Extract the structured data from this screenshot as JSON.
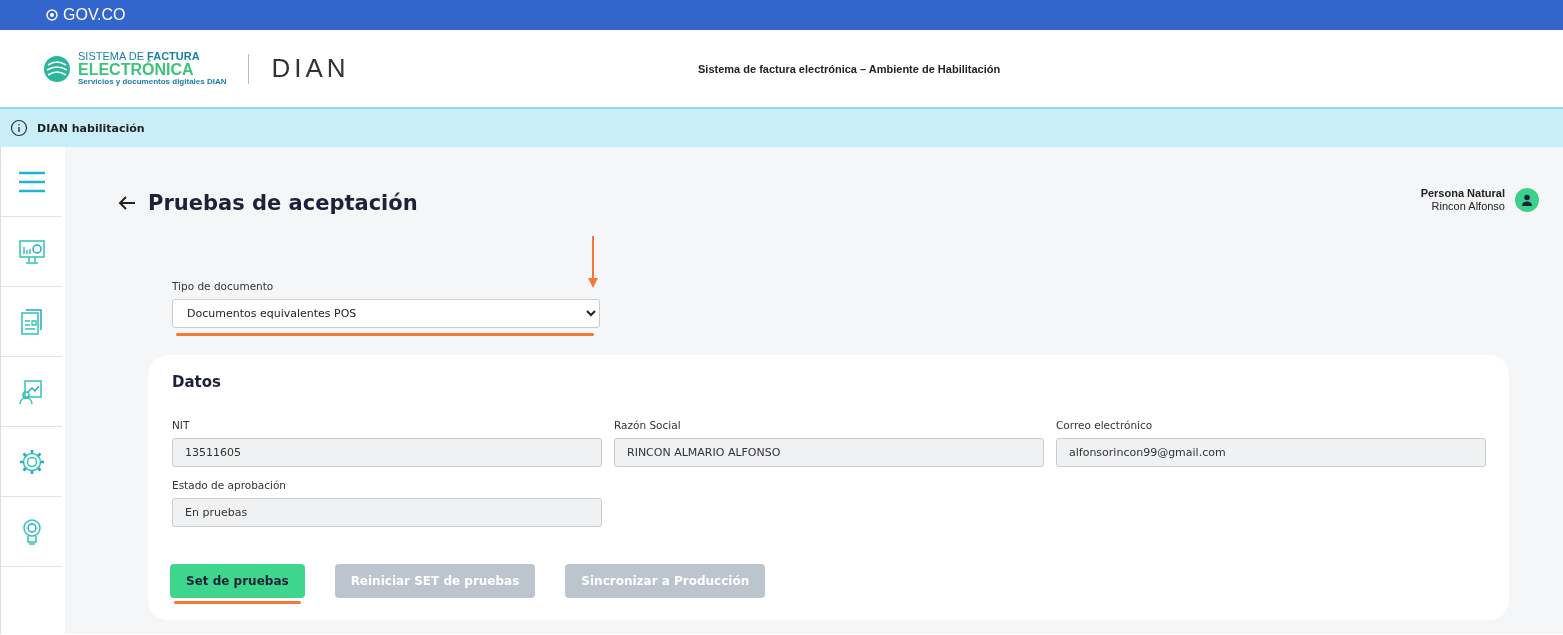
{
  "gov_bar": {
    "label": "GOV.CO"
  },
  "header": {
    "logo": {
      "line1_light": "SISTEMA DE ",
      "line1_bold": "FACTURA",
      "line2": "ELECTRÓNICA",
      "line3": "Servicios y documentos digitales DIAN"
    },
    "brand": "DIAN",
    "title": "Sistema de factura electrónica – Ambiente de Habilitación"
  },
  "info_bar": {
    "text": "DIAN habilitación"
  },
  "sidebar": {
    "items": [
      {
        "kind": "menu"
      },
      {
        "kind": "monitor"
      },
      {
        "kind": "document"
      },
      {
        "kind": "person-board"
      },
      {
        "kind": "gear"
      },
      {
        "kind": "bulb"
      }
    ]
  },
  "page": {
    "title": "Pruebas de aceptación"
  },
  "user": {
    "role": "Persona Natural",
    "name": "Rincon Alfonso"
  },
  "document_type": {
    "label": "Tipo de documento",
    "value": "Documentos equivalentes POS"
  },
  "card": {
    "title": "Datos",
    "fields": [
      {
        "label": "NIT",
        "value": "13511605"
      },
      {
        "label": "Razón Social",
        "value": "RINCON ALMARIO ALFONSO"
      },
      {
        "label": "Correo electrónico",
        "value": "alfonsorincon99@gmail.com"
      },
      {
        "label": "Estado de aprobación",
        "value": "En pruebas"
      }
    ],
    "buttons": [
      {
        "label": "Set de pruebas",
        "disabled": false
      },
      {
        "label": "Reiniciar SET de pruebas",
        "disabled": true
      },
      {
        "label": "Sincronizar a Producción",
        "disabled": true
      }
    ]
  }
}
